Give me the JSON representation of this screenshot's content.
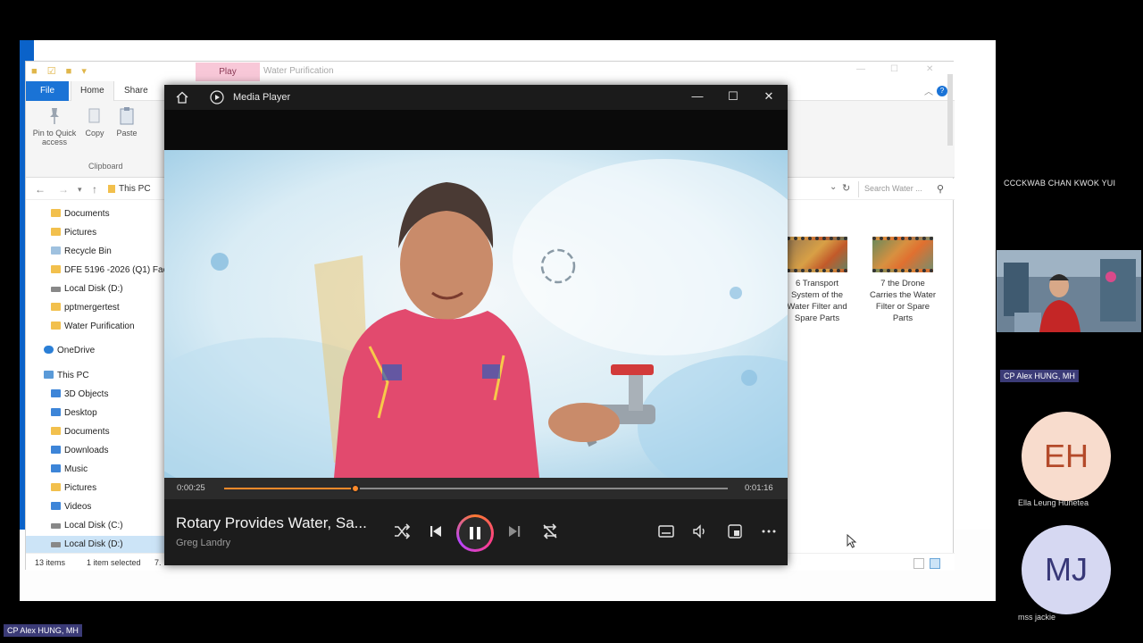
{
  "explorer": {
    "qat_icons": [
      "folder-icon",
      "check-icon",
      "folder-icon"
    ],
    "contextual_tab": "Play",
    "title": "Water Purification",
    "ribbon_tabs": [
      "File",
      "Home",
      "Share"
    ],
    "ribbon": {
      "pin_label": "Pin to Quick access",
      "copy_label": "Copy",
      "paste_label": "Paste",
      "group_label": "Clipboard"
    },
    "breadcrumb": "This PC",
    "search_placeholder": "Search Water ...",
    "nav_items": [
      {
        "label": "Documents",
        "icon": "folder"
      },
      {
        "label": "Pictures",
        "icon": "folder"
      },
      {
        "label": "Recycle Bin",
        "icon": "recycle"
      },
      {
        "label": "DFE 5196 -2026 (Q1) Fac",
        "icon": "folder"
      },
      {
        "label": "Local Disk (D:)",
        "icon": "drive"
      },
      {
        "label": "pptmergertest",
        "icon": "folder"
      },
      {
        "label": "Water Purification",
        "icon": "folder"
      },
      {
        "label": "OneDrive",
        "icon": "cloud"
      },
      {
        "label": "This PC",
        "icon": "pc"
      },
      {
        "label": "3D Objects",
        "icon": "blue"
      },
      {
        "label": "Desktop",
        "icon": "blue"
      },
      {
        "label": "Documents",
        "icon": "folder"
      },
      {
        "label": "Downloads",
        "icon": "blue"
      },
      {
        "label": "Music",
        "icon": "blue"
      },
      {
        "label": "Pictures",
        "icon": "folder"
      },
      {
        "label": "Videos",
        "icon": "blue"
      },
      {
        "label": "Local Disk (C:)",
        "icon": "drive"
      },
      {
        "label": "Local Disk (D:)",
        "icon": "drive",
        "selected": true
      }
    ],
    "files": [
      {
        "caption": "6 Transport System of the Water Filter and Spare Parts"
      },
      {
        "caption": "7 the Drone Carries the Water Filter or Spare Parts"
      }
    ],
    "status": {
      "items": "13 items",
      "selected": "1 item selected",
      "size_fragment": "7."
    }
  },
  "player": {
    "app_title": "Media Player",
    "elapsed": "0:00:25",
    "duration": "0:01:16",
    "progress_fraction": 0.26,
    "track_title": "Rotary Provides Water, Sa...",
    "artist": "Greg Landry",
    "accent": "#ff8a2a"
  },
  "meeting": {
    "presenter_name_top": "CCCKWAB CHAN KWOK YUI",
    "camera_label": "CP Alex HUNG, MH",
    "participants": [
      {
        "initials": "EH",
        "name": "Ella Leung Hunetea"
      },
      {
        "initials": "MJ",
        "name": "mss jackie"
      }
    ],
    "screen_owner_label": "CP Alex HUNG, MH"
  }
}
